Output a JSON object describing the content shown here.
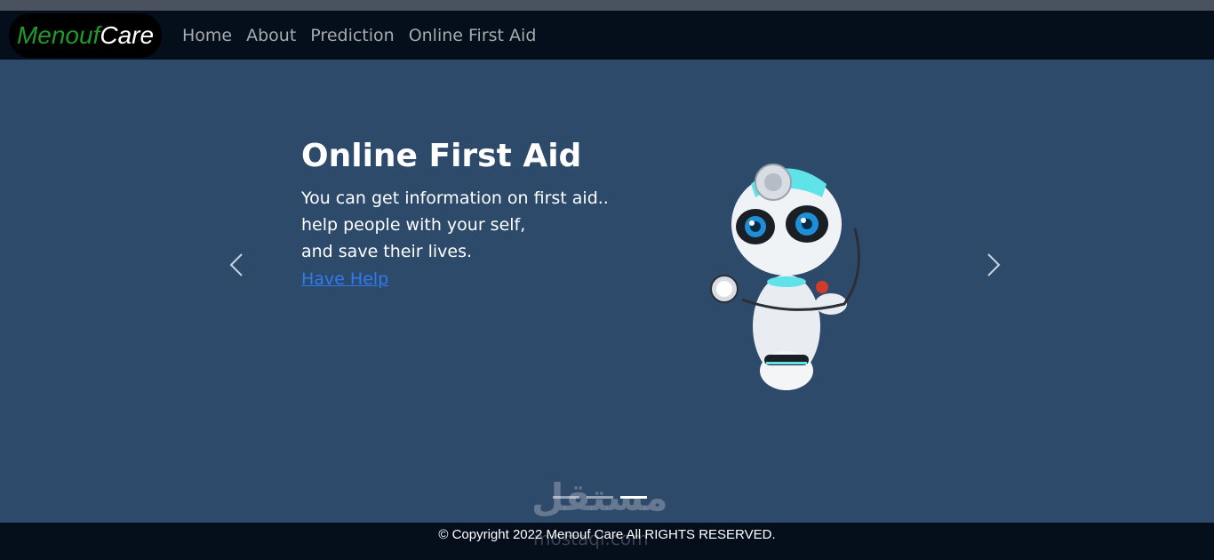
{
  "navbar": {
    "brand_part1": "Menouf",
    "brand_part2": "Care",
    "links": [
      "Home",
      "About",
      "Prediction",
      "Online First Aid"
    ]
  },
  "hero": {
    "title": "Online First Aid",
    "lines": [
      "You can get information on first aid..",
      "help people with your self,",
      "and save their lives."
    ],
    "link": "Have Help",
    "prev_icon": "chevron-left-icon",
    "next_icon": "chevron-right-icon",
    "image": "robot-doctor-illustration",
    "indicators": [
      false,
      false,
      true
    ]
  },
  "watermark": {
    "text": "مستقل",
    "site": "mostaql.com"
  },
  "footer": {
    "copyright": "© Copyright 2022 Menouf Care All RIGHTS RESERVED."
  },
  "colors": {
    "nav_bg": "#050f1c",
    "hero_bg": "#2d4a6b",
    "brand_green": "#1f9a2a",
    "link_blue": "#2e7bf0"
  }
}
